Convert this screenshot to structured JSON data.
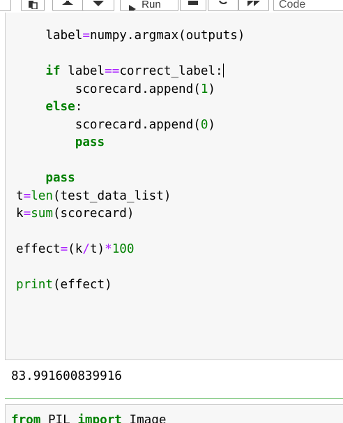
{
  "toolbar": {
    "run_label": "Run",
    "cell_type": "Code"
  },
  "code_cell": {
    "lines": [
      [
        {
          "t": "    label"
        },
        {
          "t": "=",
          "c": "op"
        },
        {
          "t": "numpy.argmax(outputs)"
        }
      ],
      [],
      [
        {
          "t": "    "
        },
        {
          "t": "if",
          "c": "kw"
        },
        {
          "t": " label"
        },
        {
          "t": "==",
          "c": "op"
        },
        {
          "t": "correct_label:"
        },
        {
          "cursor": true
        }
      ],
      [
        {
          "t": "        scorecard.append("
        },
        {
          "t": "1",
          "c": "num"
        },
        {
          "t": ")"
        }
      ],
      [
        {
          "t": "    "
        },
        {
          "t": "else",
          "c": "kw"
        },
        {
          "t": ":"
        }
      ],
      [
        {
          "t": "        scorecard.append("
        },
        {
          "t": "0",
          "c": "num"
        },
        {
          "t": ")"
        }
      ],
      [
        {
          "t": "        "
        },
        {
          "t": "pass",
          "c": "kw"
        }
      ],
      [],
      [
        {
          "t": "    "
        },
        {
          "t": "pass",
          "c": "kw"
        }
      ],
      [
        {
          "t": "t"
        },
        {
          "t": "=",
          "c": "op"
        },
        {
          "t": "len",
          "c": "bi"
        },
        {
          "t": "(test_data_list)"
        }
      ],
      [
        {
          "t": "k"
        },
        {
          "t": "=",
          "c": "op"
        },
        {
          "t": "sum",
          "c": "bi"
        },
        {
          "t": "(scorecard)"
        }
      ],
      [],
      [
        {
          "t": "effect"
        },
        {
          "t": "=",
          "c": "op"
        },
        {
          "t": "(k"
        },
        {
          "t": "/",
          "c": "op"
        },
        {
          "t": "t)"
        },
        {
          "t": "*",
          "c": "op"
        },
        {
          "t": "100",
          "c": "num"
        }
      ],
      [],
      [
        {
          "t": "print",
          "c": "bi"
        },
        {
          "t": "(effect)"
        }
      ]
    ]
  },
  "output": {
    "text": "83.991600839916"
  },
  "next_cell": {
    "lines": [
      [
        {
          "t": "from",
          "c": "kw"
        },
        {
          "t": " PIL "
        },
        {
          "t": "import",
          "c": "kw"
        },
        {
          "t": " Image"
        }
      ]
    ]
  }
}
